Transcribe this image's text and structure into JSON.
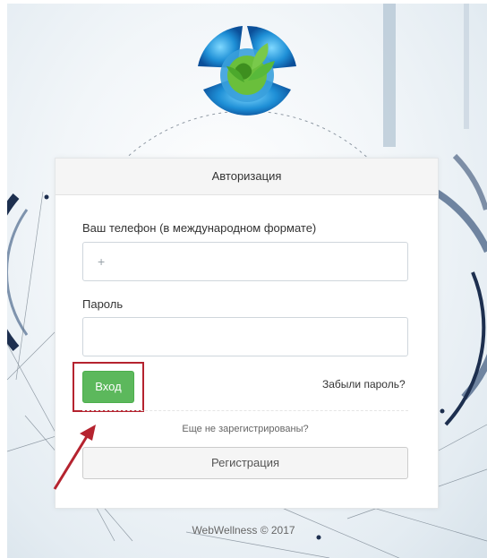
{
  "card": {
    "title": "Авторизация",
    "phone_label": "Ваш телефон (в международном формате)",
    "phone_placeholder": "+",
    "password_label": "Пароль",
    "password_value": "",
    "login_button": "Вход",
    "forgot_link": "Забыли пароль?",
    "not_registered": "Еще не зарегистрированы?",
    "register_button": "Регистрация"
  },
  "footer": {
    "copyright": "WebWellness © 2017"
  },
  "colors": {
    "login_green": "#5cb85c",
    "highlight_red": "#b5232f",
    "accent_blue": "#1f3d6b"
  },
  "icons": [
    "logo-globe-leaves-icon",
    "annotation-arrow-icon"
  ]
}
